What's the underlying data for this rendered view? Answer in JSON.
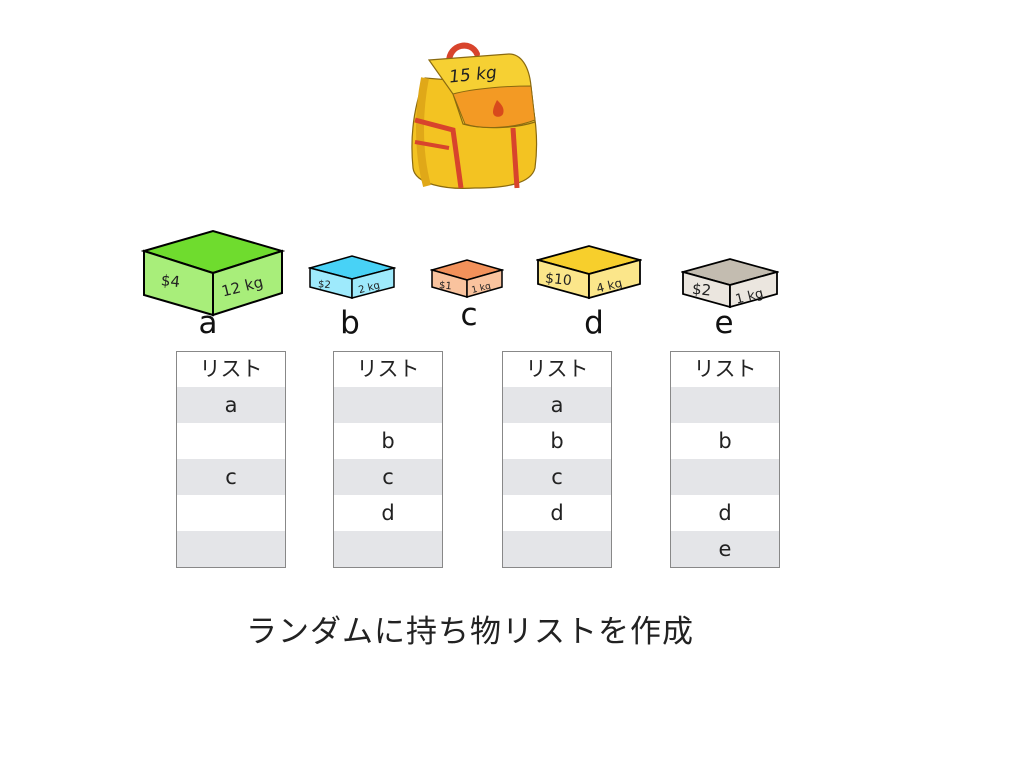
{
  "backpack": {
    "capacity_label": "15 kg"
  },
  "items": [
    {
      "letter": "a",
      "price": "$4",
      "weight": "12 kg",
      "top": "#6fdc2e",
      "front": "#a8ee7a",
      "side": "#a8ee7a"
    },
    {
      "letter": "b",
      "price": "$2",
      "weight": "2 kg",
      "top": "#48d2f6",
      "front": "#9eeafc",
      "side": "#9eeafc"
    },
    {
      "letter": "c",
      "price": "$1",
      "weight": "1 kg",
      "top": "#f2915a",
      "front": "#f9c39e",
      "side": "#f9c39e"
    },
    {
      "letter": "d",
      "price": "$10",
      "weight": "4 kg",
      "top": "#f7cf2c",
      "front": "#fbe68a",
      "side": "#fbe68a"
    },
    {
      "letter": "e",
      "price": "$2",
      "weight": "1 kg",
      "top": "#c3bcb0",
      "front": "#ebe6df",
      "side": "#ebe6df"
    }
  ],
  "lists": [
    {
      "header": "リスト",
      "rows": [
        "a",
        "",
        "c",
        "",
        ""
      ]
    },
    {
      "header": "リスト",
      "rows": [
        "",
        "b",
        "c",
        "d",
        ""
      ]
    },
    {
      "header": "リスト",
      "rows": [
        "a",
        "b",
        "c",
        "d",
        ""
      ]
    },
    {
      "header": "リスト",
      "rows": [
        "",
        "b",
        "",
        "d",
        "e"
      ]
    }
  ],
  "caption": "ランダムに持ち物リストを作成"
}
